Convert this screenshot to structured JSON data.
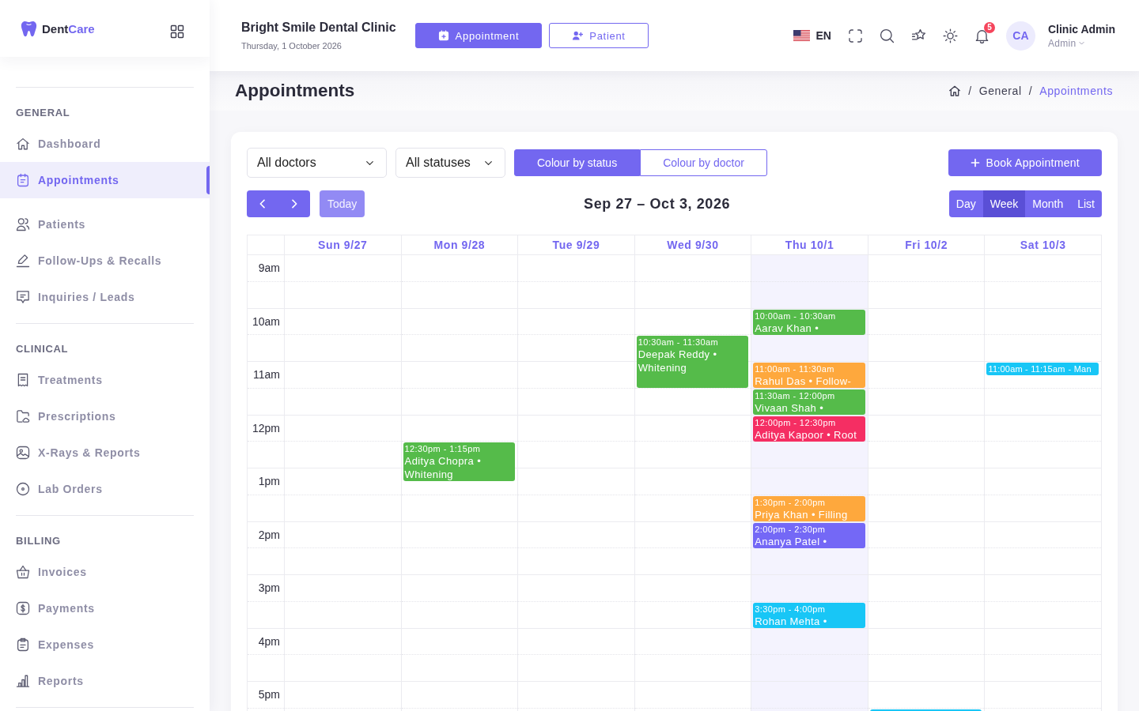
{
  "sidebar": {
    "logo": {
      "name": "Dent",
      "accent": "Care"
    },
    "sections": [
      {
        "title": "GENERAL",
        "items": [
          {
            "label": "Dashboard",
            "selected": false
          },
          {
            "label": "Appointments",
            "selected": true
          },
          {
            "label": "Patients",
            "selected": false
          },
          {
            "label": "Follow-Ups & Recalls",
            "selected": false
          },
          {
            "label": "Inquiries / Leads",
            "selected": false
          }
        ]
      },
      {
        "title": "CLINICAL",
        "items": [
          {
            "label": "Treatments",
            "selected": false
          },
          {
            "label": "Prescriptions",
            "selected": false
          },
          {
            "label": "X-Rays & Reports",
            "selected": false
          },
          {
            "label": "Lab Orders",
            "selected": false
          }
        ]
      },
      {
        "title": "BILLING",
        "items": [
          {
            "label": "Invoices",
            "selected": false
          },
          {
            "label": "Payments",
            "selected": false
          },
          {
            "label": "Expenses",
            "selected": false
          },
          {
            "label": "Reports",
            "selected": false
          }
        ]
      }
    ]
  },
  "topbar": {
    "clinic_name": "Bright Smile Dental Clinic",
    "date": "Thursday, 1 October 2026",
    "buttons": [
      {
        "label": "Appointment",
        "kind": "primary"
      },
      {
        "label": "Patient",
        "kind": "outline"
      }
    ],
    "language": "EN",
    "notifications": "5",
    "user": {
      "initials": "CA",
      "name": "Clinic Admin",
      "role": "Admin"
    }
  },
  "page_header": {
    "title": "Appointments",
    "breadcrumb": [
      {
        "kind": "home"
      },
      {
        "kind": "separator",
        "text": "/"
      },
      {
        "kind": "link",
        "text": "General"
      },
      {
        "kind": "separator",
        "text": "/"
      },
      {
        "kind": "current",
        "text": "Appointments"
      }
    ]
  },
  "toolbar": {
    "filters": [
      {
        "value": "All doctors"
      },
      {
        "value": "All statuses"
      }
    ],
    "colour_modes": [
      {
        "label": "Colour by status",
        "selected": true
      },
      {
        "label": "Colour by doctor",
        "selected": false
      }
    ],
    "book_button": "Book Appointment",
    "today_button": {
      "label": "Today",
      "disabled": true
    },
    "range": "Sep 27 – Oct 3, 2026",
    "views": [
      {
        "label": "Day",
        "selected": false
      },
      {
        "label": "Week",
        "selected": true
      },
      {
        "label": "Month",
        "selected": false
      },
      {
        "label": "List",
        "selected": false
      }
    ]
  },
  "calendar": {
    "time_labels": [
      "9am",
      "10am",
      "11am",
      "12pm",
      "1pm",
      "2pm",
      "3pm",
      "4pm",
      "5pm"
    ],
    "days": [
      {
        "label": "Sun 9/27",
        "today": false
      },
      {
        "label": "Mon 9/28",
        "today": false,
        "slots": [
          {
            "kind": "free"
          },
          {
            "kind": "free"
          },
          {
            "kind": "free"
          },
          {
            "kind": "free"
          },
          {
            "kind": "free"
          },
          {
            "kind": "free"
          },
          {
            "kind": "free"
          },
          {
            "kind": "threequarters",
            "time": "12:30pm - 1:15pm",
            "title": "Aditya Chopra • Whitening",
            "color": "#55bb4a"
          }
        ]
      },
      {
        "label": "Tue 9/29",
        "today": false
      },
      {
        "label": "Wed 9/30",
        "today": false,
        "slots": [
          {
            "kind": "free"
          },
          {
            "kind": "free"
          },
          {
            "kind": "free"
          },
          {
            "kind": "hour",
            "time": "10:30am - 11:30am",
            "title": "Deepak Reddy • Whitening",
            "color": "#55bb4a"
          }
        ]
      },
      {
        "label": "Thu 10/1",
        "today": true,
        "slots": [
          {
            "kind": "free"
          },
          {
            "kind": "free"
          },
          {
            "kind": "half",
            "time": "10:00am - 10:30am",
            "title": "Aarav Khan •",
            "color": "#55bb4a"
          },
          {
            "kind": "free"
          },
          {
            "kind": "half",
            "time": "11:00am - 11:30am",
            "title": "Rahul Das • Follow-",
            "color": "#fea83d"
          },
          {
            "kind": "half",
            "time": "11:30am - 12:00pm",
            "title": "Vivaan Shah •",
            "color": "#55bb4a"
          },
          {
            "kind": "half",
            "time": "12:00pm - 12:30pm",
            "title": "Aditya Kapoor • Root",
            "color": "#f52e63"
          },
          {
            "kind": "free"
          },
          {
            "kind": "free"
          },
          {
            "kind": "half",
            "time": "1:30pm - 2:00pm",
            "title": "Priya Khan • Filling",
            "color": "#fea83d"
          },
          {
            "kind": "half",
            "time": "2:00pm - 2:30pm",
            "title": "Ananya Patel •",
            "color": "#7468f6"
          },
          {
            "kind": "free"
          },
          {
            "kind": "free"
          },
          {
            "kind": "half",
            "time": "3:30pm - 4:00pm",
            "title": "Rohan Mehta •",
            "color": "#18c6f6"
          }
        ]
      },
      {
        "label": "Fri 10/2",
        "today": false,
        "slots": [
          {
            "kind": "free"
          },
          {
            "kind": "free"
          },
          {
            "kind": "free"
          },
          {
            "kind": "free"
          },
          {
            "kind": "free"
          },
          {
            "kind": "free"
          },
          {
            "kind": "free"
          },
          {
            "kind": "free"
          },
          {
            "kind": "free"
          },
          {
            "kind": "free"
          },
          {
            "kind": "free"
          },
          {
            "kind": "free"
          },
          {
            "kind": "free"
          },
          {
            "kind": "free"
          },
          {
            "kind": "free"
          },
          {
            "kind": "free"
          },
          {
            "kind": "free"
          },
          {
            "kind": "half",
            "color": "#18c6f6"
          }
        ]
      },
      {
        "label": "Sat 10/3",
        "today": false,
        "slots": [
          {
            "kind": "free"
          },
          {
            "kind": "free"
          },
          {
            "kind": "free"
          },
          {
            "kind": "free"
          },
          {
            "kind": "quarter",
            "time": "11:00am - 11:15am",
            "title": "- Man",
            "color": "#18c6f6"
          }
        ]
      }
    ]
  }
}
